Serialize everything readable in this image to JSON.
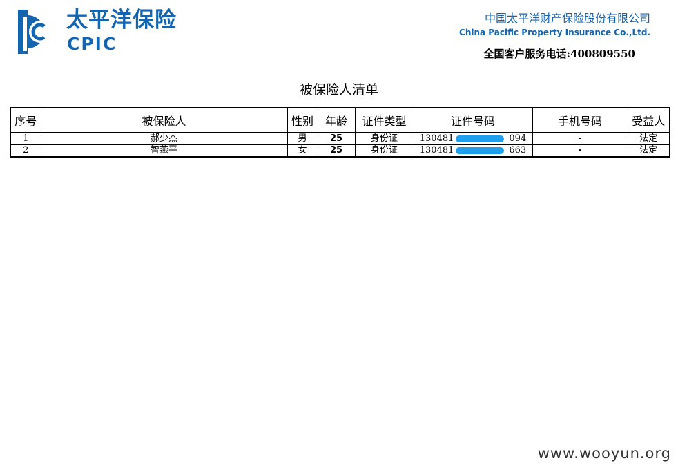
{
  "header": {
    "logo_cn": "太平洋保险",
    "logo_en": "CPIC",
    "company_cn": "中国太平洋财产保险股份有限公司",
    "company_en": "China Pacific Property Insurance Co.,Ltd.",
    "hotline": "全国客户服务电话:400809550",
    "brand_color": "#1465b0"
  },
  "document": {
    "title": "被保险人清单"
  },
  "table": {
    "headers": [
      "序号",
      "被保险人",
      "性别",
      "年龄",
      "证件类型",
      "证件号码",
      "手机号码",
      "受益人"
    ],
    "rows": [
      {
        "no": "1",
        "name": "郝少杰",
        "gender": "男",
        "age": "25",
        "id_type": "身份证",
        "id_prefix": "130481",
        "id_suffix": "094",
        "phone": "-",
        "beneficiary": "法定"
      },
      {
        "no": "2",
        "name": "智燕平",
        "gender": "女",
        "age": "25",
        "id_type": "身份证",
        "id_prefix": "130481",
        "id_suffix": "663",
        "phone": "-",
        "beneficiary": "法定"
      }
    ]
  },
  "redaction_color": "#1ea0ef",
  "watermark": "www.wooyun.org"
}
